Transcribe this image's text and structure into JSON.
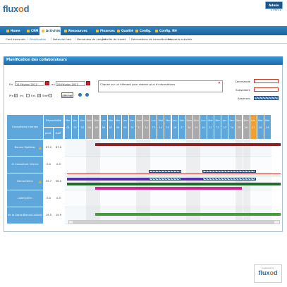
{
  "app": {
    "logo_prefix": "flux",
    "logo_o": "o",
    "logo_suffix": "d",
    "user_name": "DRF Demo",
    "date": "27/8/12"
  },
  "nav": {
    "tabs": [
      {
        "label": "Home"
      },
      {
        "label": "CRM"
      },
      {
        "label": "Activités",
        "active": true
      },
      {
        "label": "Ressources"
      },
      {
        "label": "Finances"
      },
      {
        "label": "Qualité"
      },
      {
        "label": "Config."
      },
      {
        "label": "Config. RH"
      }
    ],
    "admin_label": "Admin"
  },
  "subnav": {
    "items": [
      {
        "label": "Cmd mensuels"
      },
      {
        "label": "Planification",
        "active": true
      },
      {
        "label": "Notes de frais"
      },
      {
        "label": "Demandes de congés"
      },
      {
        "label": "Arrêts de travail"
      },
      {
        "label": "Déclarations de compétences"
      },
      {
        "label": "Rapports activités"
      }
    ]
  },
  "panel": {
    "title": "Planification des collaborateurs",
    "du_label": "Du",
    "du_value": "11 Février 2012",
    "au_label": "au",
    "au_value": "29 Février 2012",
    "filters": [
      {
        "label": "Pro",
        "checked": true
      },
      {
        "label": "Int.",
        "checked": false
      },
      {
        "label": "Ext.",
        "checked": true
      },
      {
        "label": "Staff",
        "checked": false
      }
    ],
    "afficher_label": "Afficher",
    "info_text": "Cliquez sur un élément pour obtenir plus d'informations",
    "legend": [
      {
        "label": "Commande",
        "color": "#ffffff",
        "border": "#c0392b"
      },
      {
        "label": "Subsidiaire",
        "color": "#ffffff",
        "border": "#c0392b"
      },
      {
        "label": "Absences",
        "color": "hatched",
        "border": "#1f3f70"
      }
    ]
  },
  "grid": {
    "header_consultants": "Consultants internes",
    "header_disponibilite": "Disponibilité",
    "header_prod": "prod.",
    "header_staff": "staff",
    "days": [
      {
        "d": "Mer",
        "n": "01",
        "we": false
      },
      {
        "d": "Jeu",
        "n": "02",
        "we": false
      },
      {
        "d": "Ven",
        "n": "03",
        "we": false
      },
      {
        "d": "Sam",
        "n": "04",
        "we": true
      },
      {
        "d": "Dim",
        "n": "05",
        "we": true
      },
      {
        "d": "Lun",
        "n": "06",
        "we": false
      },
      {
        "d": "Mar",
        "n": "07",
        "we": false
      },
      {
        "d": "Mer",
        "n": "08",
        "we": false
      },
      {
        "d": "Jeu",
        "n": "09",
        "we": false
      },
      {
        "d": "Ven",
        "n": "10",
        "we": false
      },
      {
        "d": "Sam",
        "n": "11",
        "we": true
      },
      {
        "d": "Dim",
        "n": "12",
        "we": true
      },
      {
        "d": "Lun",
        "n": "13",
        "we": false
      },
      {
        "d": "Mar",
        "n": "14",
        "we": false
      },
      {
        "d": "Mer",
        "n": "15",
        "we": false
      },
      {
        "d": "Jeu",
        "n": "16",
        "we": false
      },
      {
        "d": "Ven",
        "n": "17",
        "we": false
      },
      {
        "d": "Sam",
        "n": "18",
        "we": true
      },
      {
        "d": "Dim",
        "n": "19",
        "we": true
      },
      {
        "d": "Lun",
        "n": "20",
        "we": false
      },
      {
        "d": "Mar",
        "n": "21",
        "we": false
      },
      {
        "d": "Mer",
        "n": "22",
        "we": false
      },
      {
        "d": "Jeu",
        "n": "23",
        "we": false
      },
      {
        "d": "Ven",
        "n": "24",
        "we": false
      },
      {
        "d": "Sam",
        "n": "25",
        "we": true
      },
      {
        "d": "Dim",
        "n": "26",
        "we": true
      },
      {
        "d": "Lun",
        "n": "27",
        "we": false,
        "today": true
      },
      {
        "d": "Mar",
        "n": "28",
        "we": false
      },
      {
        "d": "Mer",
        "n": "29",
        "we": false
      }
    ],
    "rows": [
      {
        "name": "Bourne Matthias",
        "prod": "67.0",
        "staff": "67.0",
        "warn": true
      },
      {
        "name": "Ci Consultant interne",
        "prod": "0.0",
        "staff": "0.0",
        "warn": false
      },
      {
        "name": "Demo Demo",
        "prod": "35.7",
        "staff": "58.0",
        "warn": true
      },
      {
        "name": "Lobel Julien",
        "prod": "0.0",
        "staff": "0.0",
        "warn": false
      },
      {
        "name": "de la Garza Blanco Ludovic",
        "prod": "19.5",
        "staff": "19.9",
        "warn": false
      }
    ]
  },
  "footer": {
    "powered_label": "powered by",
    "logo_prefix": "flux",
    "logo_o": "o",
    "logo_suffix": "d"
  }
}
